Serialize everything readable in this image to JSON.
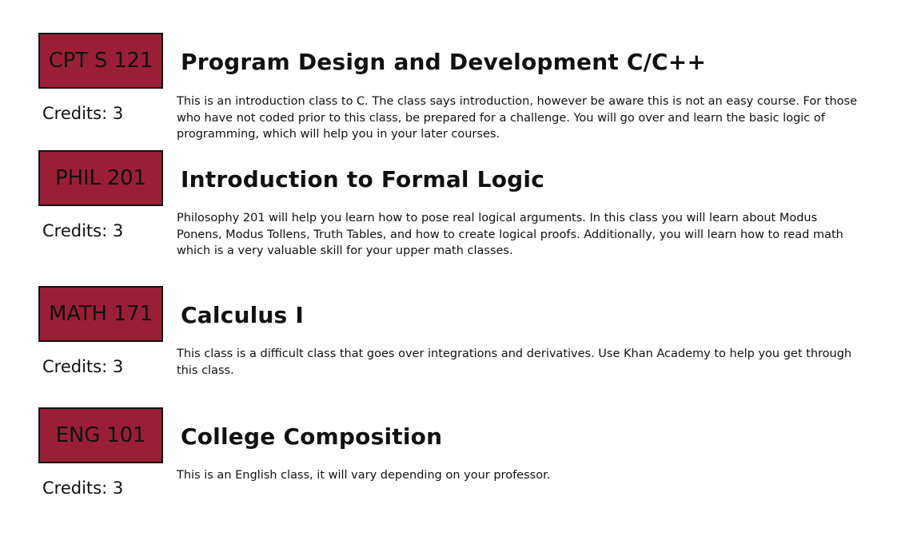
{
  "theme": {
    "badge_color": "#9a1f36"
  },
  "courses": [
    {
      "code": "CPT S 121",
      "title": "Program Design and Development C/C++",
      "credits": "Credits: 3",
      "description": "This is an introduction class to C. The class says introduction, however be aware this is not an easy course. For those who have not coded prior to this class, be prepared for a challenge. You will go over and learn the basic logic of programming, which will help you in your later courses."
    },
    {
      "code": "PHIL 201",
      "title": "Introduction to Formal Logic",
      "credits": "Credits: 3",
      "description": "Philosophy 201 will help you learn how to pose real logical arguments. In this class you will learn about Modus Ponens, Modus Tollens, Truth Tables, and how to create logical proofs. Additionally, you will learn how to read math which is a very valuable skill for your upper math classes."
    },
    {
      "code": "MATH 171",
      "title": "Calculus I",
      "credits": "Credits: 3",
      "description": "This class is a difficult class that goes over integrations and derivatives. Use Khan Academy to help you get through this class."
    },
    {
      "code": "ENG 101",
      "title": "College Composition",
      "credits": "Credits: 3",
      "description": "This is an English class, it will vary depending on your professor."
    }
  ]
}
